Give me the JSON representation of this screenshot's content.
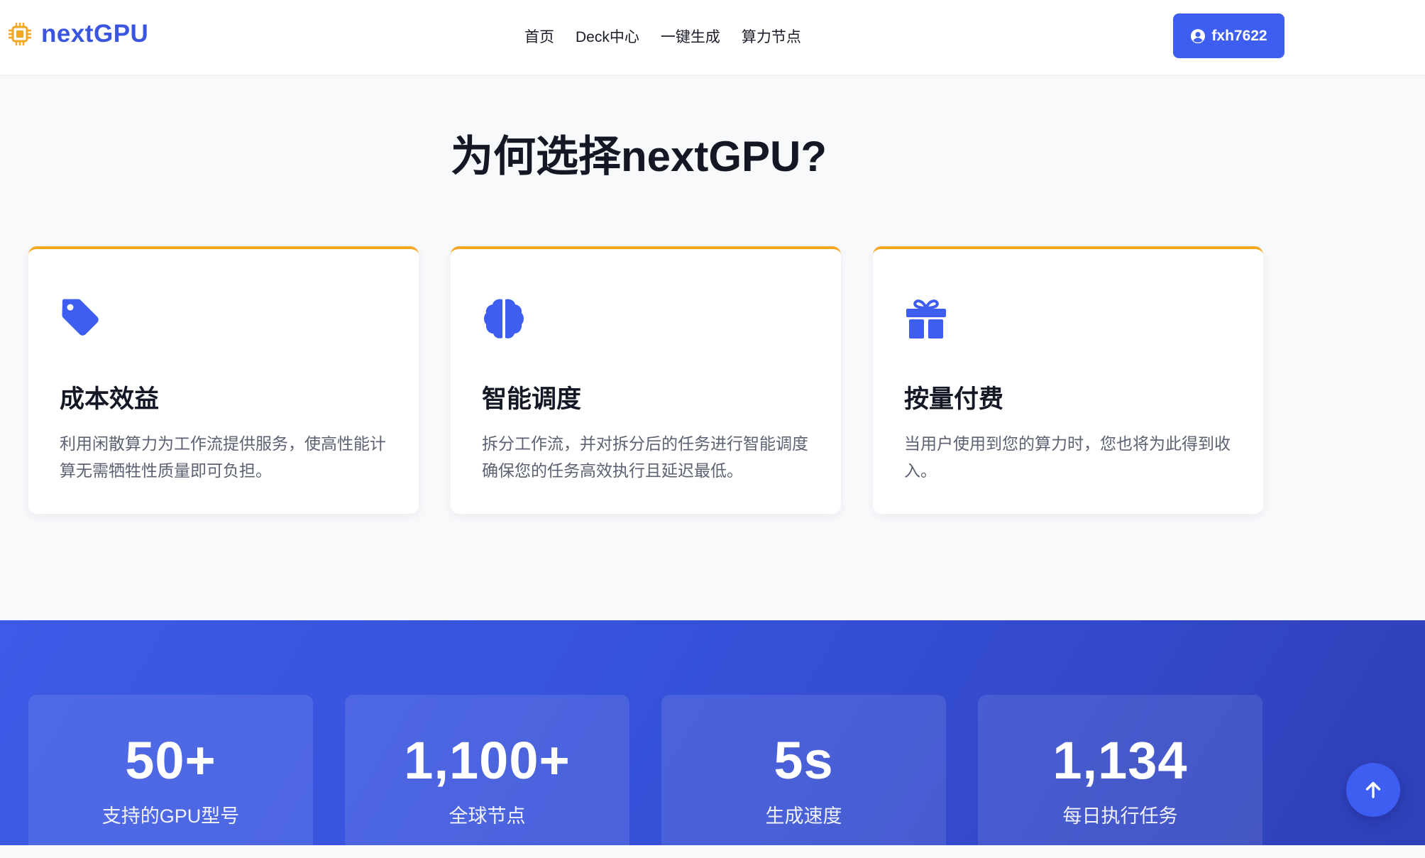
{
  "header": {
    "logo_text": "nextGPU",
    "nav": [
      "首页",
      "Deck中心",
      "一键生成",
      "算力节点"
    ],
    "user_label": "fxh7622"
  },
  "features": {
    "title": "为何选择nextGPU?",
    "cards": [
      {
        "icon": "tag-icon",
        "title": "成本效益",
        "desc": "利用闲散算力为工作流提供服务，使高性能计算无需牺牲性质量即可负担。"
      },
      {
        "icon": "brain-icon",
        "title": "智能调度",
        "desc": "拆分工作流，并对拆分后的任务进行智能调度确保您的任务高效执行且延迟最低。"
      },
      {
        "icon": "gift-icon",
        "title": "按量付费",
        "desc": "当用户使用到您的算力时，您也将为此得到收入。"
      }
    ]
  },
  "stats": [
    {
      "value": "50+",
      "label": "支持的GPU型号"
    },
    {
      "value": "1,100+",
      "label": "全球节点"
    },
    {
      "value": "5s",
      "label": "生成速度"
    },
    {
      "value": "1,134",
      "label": "每日执行任务"
    }
  ],
  "colors": {
    "brand": "#3d5ef0",
    "accent": "#f5a623"
  }
}
